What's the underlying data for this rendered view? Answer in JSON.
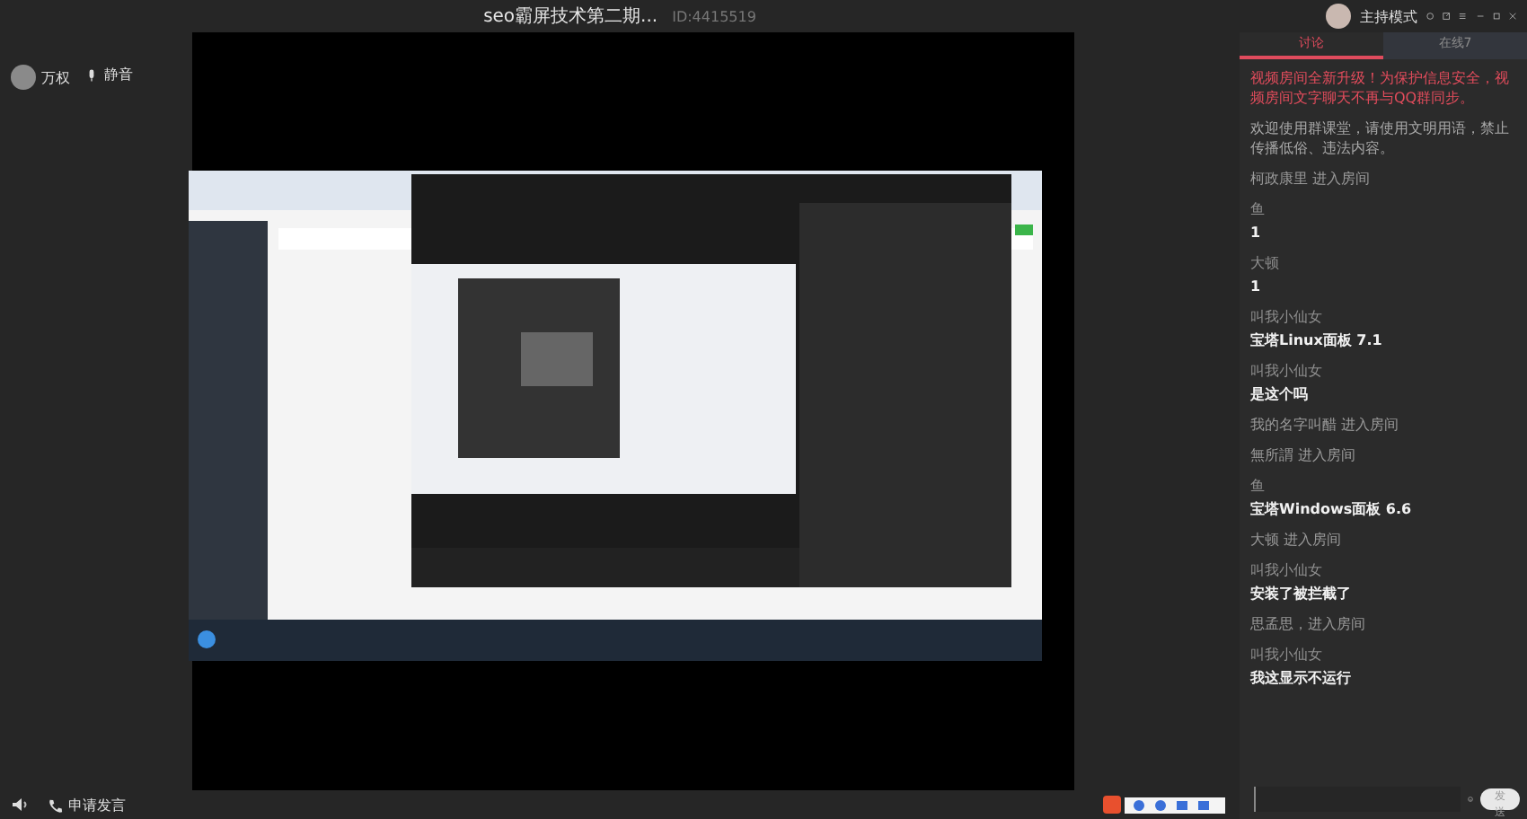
{
  "window": {
    "title": "seo霸屏技术第二期...",
    "room_id": "ID:4415519"
  },
  "host": {
    "name": "万权",
    "mic_label": "静音"
  },
  "mode": {
    "label": "主持模式"
  },
  "bottom_bar": {
    "speak_label": "申请发言"
  },
  "tabs": [
    {
      "label": "讨论",
      "selected": true
    },
    {
      "label": "在线7",
      "selected": false
    }
  ],
  "chat": [
    {
      "kind": "notice",
      "text": "视频房间全新升级！为保护信息安全，视频房间文字聊天不再与QQ群同步。"
    },
    {
      "kind": "info",
      "text": "欢迎使用群课堂，请使用文明用语，禁止传播低俗、违法内容。"
    },
    {
      "kind": "join",
      "text": "柯政康里 进入房间"
    },
    {
      "kind": "message",
      "name": "鱼",
      "text": "1"
    },
    {
      "kind": "message",
      "name": "大顿",
      "text": "1"
    },
    {
      "kind": "message",
      "name": "叫我小仙女",
      "text": "宝塔Linux面板 7.1"
    },
    {
      "kind": "message",
      "name": "叫我小仙女",
      "text": "是这个吗"
    },
    {
      "kind": "join",
      "text": "我的名字叫醋 进入房间"
    },
    {
      "kind": "join",
      "text": "無所謂 进入房间"
    },
    {
      "kind": "message",
      "name": "鱼",
      "text": "宝塔Windows面板 6.6"
    },
    {
      "kind": "join",
      "text": "大顿 进入房间"
    },
    {
      "kind": "message",
      "name": "叫我小仙女",
      "text": "安装了被拦截了"
    },
    {
      "kind": "join",
      "text": "思孟思，进入房间"
    },
    {
      "kind": "message",
      "name": "叫我小仙女",
      "text": "我这显示不运行"
    }
  ],
  "composer": {
    "send_label": "发送"
  }
}
